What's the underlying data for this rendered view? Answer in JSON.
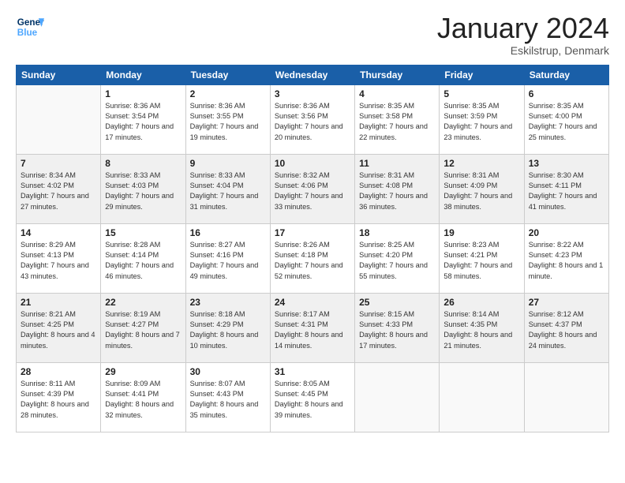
{
  "header": {
    "logo_line1": "General",
    "logo_line2": "Blue",
    "month": "January 2024",
    "location": "Eskilstrup, Denmark"
  },
  "weekdays": [
    "Sunday",
    "Monday",
    "Tuesday",
    "Wednesday",
    "Thursday",
    "Friday",
    "Saturday"
  ],
  "weeks": [
    [
      {
        "day": "",
        "sunrise": "",
        "sunset": "",
        "daylight": ""
      },
      {
        "day": "1",
        "sunrise": "Sunrise: 8:36 AM",
        "sunset": "Sunset: 3:54 PM",
        "daylight": "Daylight: 7 hours and 17 minutes."
      },
      {
        "day": "2",
        "sunrise": "Sunrise: 8:36 AM",
        "sunset": "Sunset: 3:55 PM",
        "daylight": "Daylight: 7 hours and 19 minutes."
      },
      {
        "day": "3",
        "sunrise": "Sunrise: 8:36 AM",
        "sunset": "Sunset: 3:56 PM",
        "daylight": "Daylight: 7 hours and 20 minutes."
      },
      {
        "day": "4",
        "sunrise": "Sunrise: 8:35 AM",
        "sunset": "Sunset: 3:58 PM",
        "daylight": "Daylight: 7 hours and 22 minutes."
      },
      {
        "day": "5",
        "sunrise": "Sunrise: 8:35 AM",
        "sunset": "Sunset: 3:59 PM",
        "daylight": "Daylight: 7 hours and 23 minutes."
      },
      {
        "day": "6",
        "sunrise": "Sunrise: 8:35 AM",
        "sunset": "Sunset: 4:00 PM",
        "daylight": "Daylight: 7 hours and 25 minutes."
      }
    ],
    [
      {
        "day": "7",
        "sunrise": "Sunrise: 8:34 AM",
        "sunset": "Sunset: 4:02 PM",
        "daylight": "Daylight: 7 hours and 27 minutes."
      },
      {
        "day": "8",
        "sunrise": "Sunrise: 8:33 AM",
        "sunset": "Sunset: 4:03 PM",
        "daylight": "Daylight: 7 hours and 29 minutes."
      },
      {
        "day": "9",
        "sunrise": "Sunrise: 8:33 AM",
        "sunset": "Sunset: 4:04 PM",
        "daylight": "Daylight: 7 hours and 31 minutes."
      },
      {
        "day": "10",
        "sunrise": "Sunrise: 8:32 AM",
        "sunset": "Sunset: 4:06 PM",
        "daylight": "Daylight: 7 hours and 33 minutes."
      },
      {
        "day": "11",
        "sunrise": "Sunrise: 8:31 AM",
        "sunset": "Sunset: 4:08 PM",
        "daylight": "Daylight: 7 hours and 36 minutes."
      },
      {
        "day": "12",
        "sunrise": "Sunrise: 8:31 AM",
        "sunset": "Sunset: 4:09 PM",
        "daylight": "Daylight: 7 hours and 38 minutes."
      },
      {
        "day": "13",
        "sunrise": "Sunrise: 8:30 AM",
        "sunset": "Sunset: 4:11 PM",
        "daylight": "Daylight: 7 hours and 41 minutes."
      }
    ],
    [
      {
        "day": "14",
        "sunrise": "Sunrise: 8:29 AM",
        "sunset": "Sunset: 4:13 PM",
        "daylight": "Daylight: 7 hours and 43 minutes."
      },
      {
        "day": "15",
        "sunrise": "Sunrise: 8:28 AM",
        "sunset": "Sunset: 4:14 PM",
        "daylight": "Daylight: 7 hours and 46 minutes."
      },
      {
        "day": "16",
        "sunrise": "Sunrise: 8:27 AM",
        "sunset": "Sunset: 4:16 PM",
        "daylight": "Daylight: 7 hours and 49 minutes."
      },
      {
        "day": "17",
        "sunrise": "Sunrise: 8:26 AM",
        "sunset": "Sunset: 4:18 PM",
        "daylight": "Daylight: 7 hours and 52 minutes."
      },
      {
        "day": "18",
        "sunrise": "Sunrise: 8:25 AM",
        "sunset": "Sunset: 4:20 PM",
        "daylight": "Daylight: 7 hours and 55 minutes."
      },
      {
        "day": "19",
        "sunrise": "Sunrise: 8:23 AM",
        "sunset": "Sunset: 4:21 PM",
        "daylight": "Daylight: 7 hours and 58 minutes."
      },
      {
        "day": "20",
        "sunrise": "Sunrise: 8:22 AM",
        "sunset": "Sunset: 4:23 PM",
        "daylight": "Daylight: 8 hours and 1 minute."
      }
    ],
    [
      {
        "day": "21",
        "sunrise": "Sunrise: 8:21 AM",
        "sunset": "Sunset: 4:25 PM",
        "daylight": "Daylight: 8 hours and 4 minutes."
      },
      {
        "day": "22",
        "sunrise": "Sunrise: 8:19 AM",
        "sunset": "Sunset: 4:27 PM",
        "daylight": "Daylight: 8 hours and 7 minutes."
      },
      {
        "day": "23",
        "sunrise": "Sunrise: 8:18 AM",
        "sunset": "Sunset: 4:29 PM",
        "daylight": "Daylight: 8 hours and 10 minutes."
      },
      {
        "day": "24",
        "sunrise": "Sunrise: 8:17 AM",
        "sunset": "Sunset: 4:31 PM",
        "daylight": "Daylight: 8 hours and 14 minutes."
      },
      {
        "day": "25",
        "sunrise": "Sunrise: 8:15 AM",
        "sunset": "Sunset: 4:33 PM",
        "daylight": "Daylight: 8 hours and 17 minutes."
      },
      {
        "day": "26",
        "sunrise": "Sunrise: 8:14 AM",
        "sunset": "Sunset: 4:35 PM",
        "daylight": "Daylight: 8 hours and 21 minutes."
      },
      {
        "day": "27",
        "sunrise": "Sunrise: 8:12 AM",
        "sunset": "Sunset: 4:37 PM",
        "daylight": "Daylight: 8 hours and 24 minutes."
      }
    ],
    [
      {
        "day": "28",
        "sunrise": "Sunrise: 8:11 AM",
        "sunset": "Sunset: 4:39 PM",
        "daylight": "Daylight: 8 hours and 28 minutes."
      },
      {
        "day": "29",
        "sunrise": "Sunrise: 8:09 AM",
        "sunset": "Sunset: 4:41 PM",
        "daylight": "Daylight: 8 hours and 32 minutes."
      },
      {
        "day": "30",
        "sunrise": "Sunrise: 8:07 AM",
        "sunset": "Sunset: 4:43 PM",
        "daylight": "Daylight: 8 hours and 35 minutes."
      },
      {
        "day": "31",
        "sunrise": "Sunrise: 8:05 AM",
        "sunset": "Sunset: 4:45 PM",
        "daylight": "Daylight: 8 hours and 39 minutes."
      },
      {
        "day": "",
        "sunrise": "",
        "sunset": "",
        "daylight": ""
      },
      {
        "day": "",
        "sunrise": "",
        "sunset": "",
        "daylight": ""
      },
      {
        "day": "",
        "sunrise": "",
        "sunset": "",
        "daylight": ""
      }
    ]
  ]
}
